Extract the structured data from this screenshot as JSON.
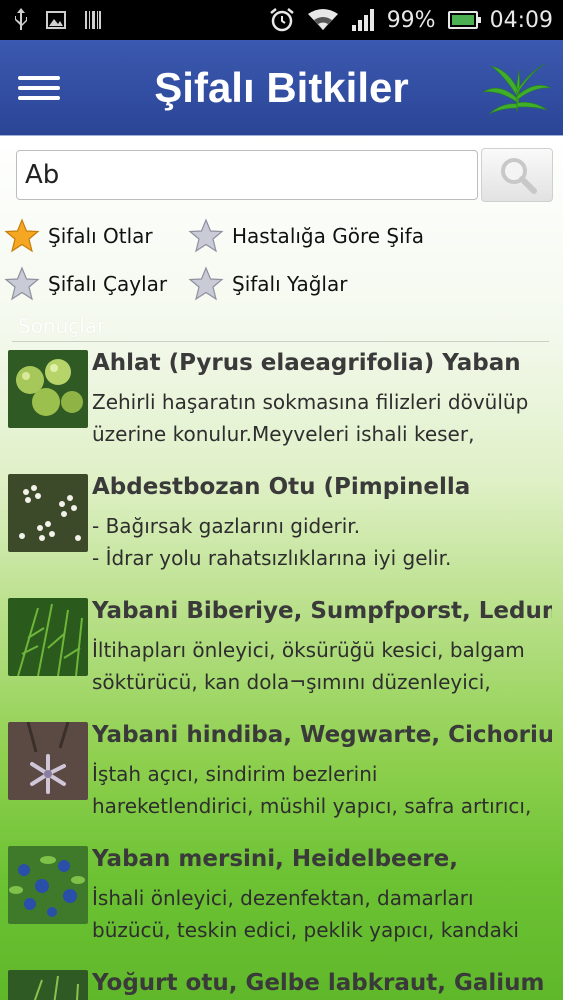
{
  "status_bar": {
    "battery_percent": "99%",
    "time": "04:09",
    "icons": [
      "usb-icon",
      "image-icon",
      "barcode-icon",
      "alarm-icon",
      "wifi-icon",
      "signal-icon",
      "battery-icon"
    ]
  },
  "app_bar": {
    "title": "Şifalı Bitkiler",
    "menu_icon": "hamburger-icon",
    "logo": "plant-logo"
  },
  "search": {
    "value": "Ab",
    "button_icon": "magnifier-icon"
  },
  "categories": [
    {
      "label": "Şifalı Otlar",
      "selected": true
    },
    {
      "label": "Hastalığa Göre Şifa",
      "selected": false
    },
    {
      "label": "Şifalı Çaylar",
      "selected": false
    },
    {
      "label": "Şifalı Yağlar",
      "selected": false
    }
  ],
  "results": {
    "label": "Sonuçlar",
    "items": [
      {
        "title": "Ahlat (Pyrus elaeagrifolia) Yaban",
        "description": "Zehirli haşaratın sokmasına filizleri dövülüp\nüzerine konulur.Meyveleri ishali keser,"
      },
      {
        "title": "Abdestbozan Otu (Pimpinella",
        "description": "- Bağırsak gazlarını giderir.\n- İdrar yolu rahatsızlıklarına iyi gelir."
      },
      {
        "title": "Yabani Biberiye, Sumpfporst, Ledum",
        "description": "İltihapları önleyici, öksürüğü kesici, balgam\nsöktürücü, kan dola¬şımını düzenleyici,"
      },
      {
        "title": "Yabani hindiba, Wegwarte, Cichorium",
        "description": "İştah açıcı, sindirim bezlerini\nhareketlendirici, müshil yapıcı, safra artırıcı,"
      },
      {
        "title": "Yaban mersini, Heidelbeere,",
        "description": "İshali önleyici, dezenfektan, damarları\nbüzücü, teskin edici, peklik yapıcı, kandaki"
      },
      {
        "title": "Yoğurt otu, Gelbe labkraut, Galium",
        "description": ""
      }
    ]
  }
}
